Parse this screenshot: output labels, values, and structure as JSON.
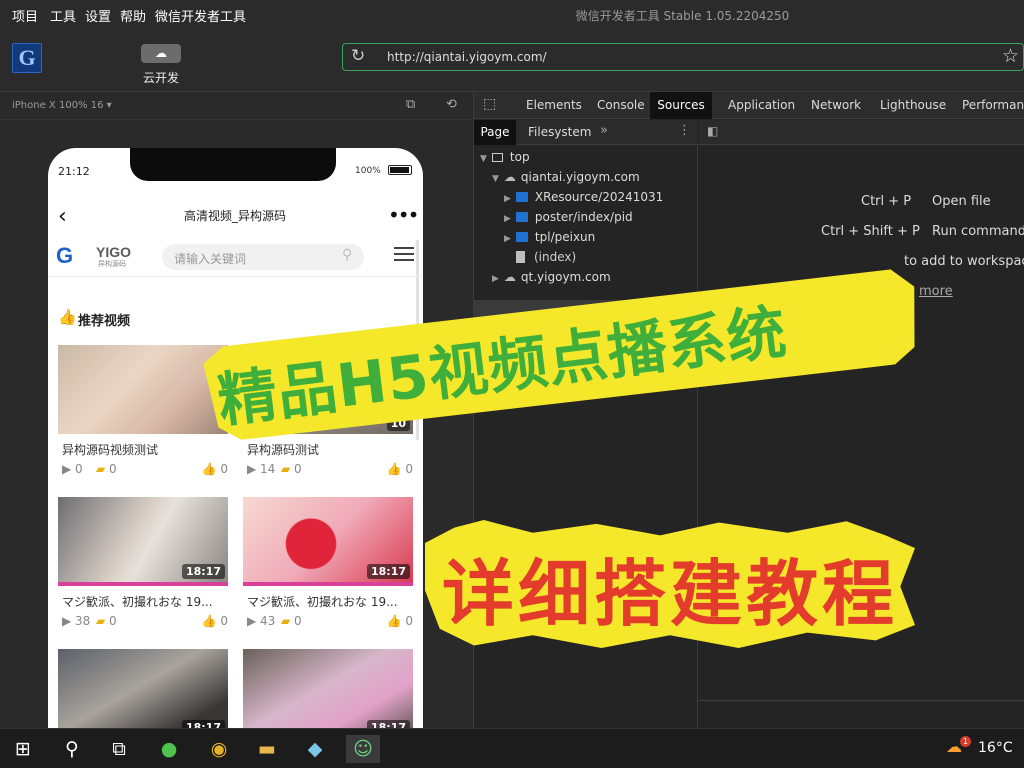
{
  "menu": [
    "项目",
    "工具",
    "设置",
    "帮助",
    "微信开发者工具"
  ],
  "app_title": "微信开发者工具 Stable 1.05.2204250",
  "toolbar": {
    "logo": "G",
    "cloud_label": "云开发"
  },
  "url": "http://qiantai.yigoym.com/",
  "simulator": {
    "device_label": "iPhone X 100% 16 ▾"
  },
  "phone": {
    "time": "21:12",
    "battery": "100%",
    "nav_title": "高清视频_异构源码",
    "more": "•••",
    "logo_text": "YIGO",
    "logo_sub": "异构源码",
    "search_placeholder": "请输入关键词",
    "section_title": "推荐视频",
    "videos": [
      {
        "title": "异构源码视频测试",
        "plays": "0",
        "coins": "0",
        "likes": "0",
        "duration": ""
      },
      {
        "title": "异构源码测试",
        "plays": "14",
        "coins": "0",
        "likes": "0",
        "duration": "10"
      },
      {
        "title": "マジ歓派、初撮れおな 19...",
        "plays": "38",
        "coins": "0",
        "likes": "0",
        "duration": "18:17"
      },
      {
        "title": "マジ歓派、初撮れおな 19...",
        "plays": "43",
        "coins": "0",
        "likes": "0",
        "duration": "18:17"
      },
      {
        "title": "",
        "plays": "",
        "coins": "",
        "likes": "",
        "duration": "18:17"
      },
      {
        "title": "",
        "plays": "",
        "coins": "",
        "likes": "",
        "duration": "18:17"
      }
    ]
  },
  "devtools": {
    "tabs": [
      "Elements",
      "Console",
      "Sources",
      "Application",
      "Network",
      "Lighthouse",
      "Performance"
    ],
    "active_tab": "Sources",
    "subtabs": [
      "Page",
      "Filesystem"
    ],
    "tree": [
      "top",
      "qiantai.yigoym.com",
      "XResource/20241031",
      "poster/index/pid",
      "tpl/peixun",
      "(index)",
      "qt.yigoym.com"
    ],
    "shortcuts": [
      {
        "keys": "Ctrl + P",
        "action": "Open file"
      },
      {
        "keys": "Ctrl + Shift + P",
        "action": "Run command"
      }
    ],
    "drop_hint": "to add to workspace",
    "learn_more": "more"
  },
  "overlay": {
    "line1": "精品H5视频点播系统",
    "line2": "详细搭建教程"
  },
  "taskbar": {
    "temperature": "16°C",
    "notif_badge": "1"
  }
}
